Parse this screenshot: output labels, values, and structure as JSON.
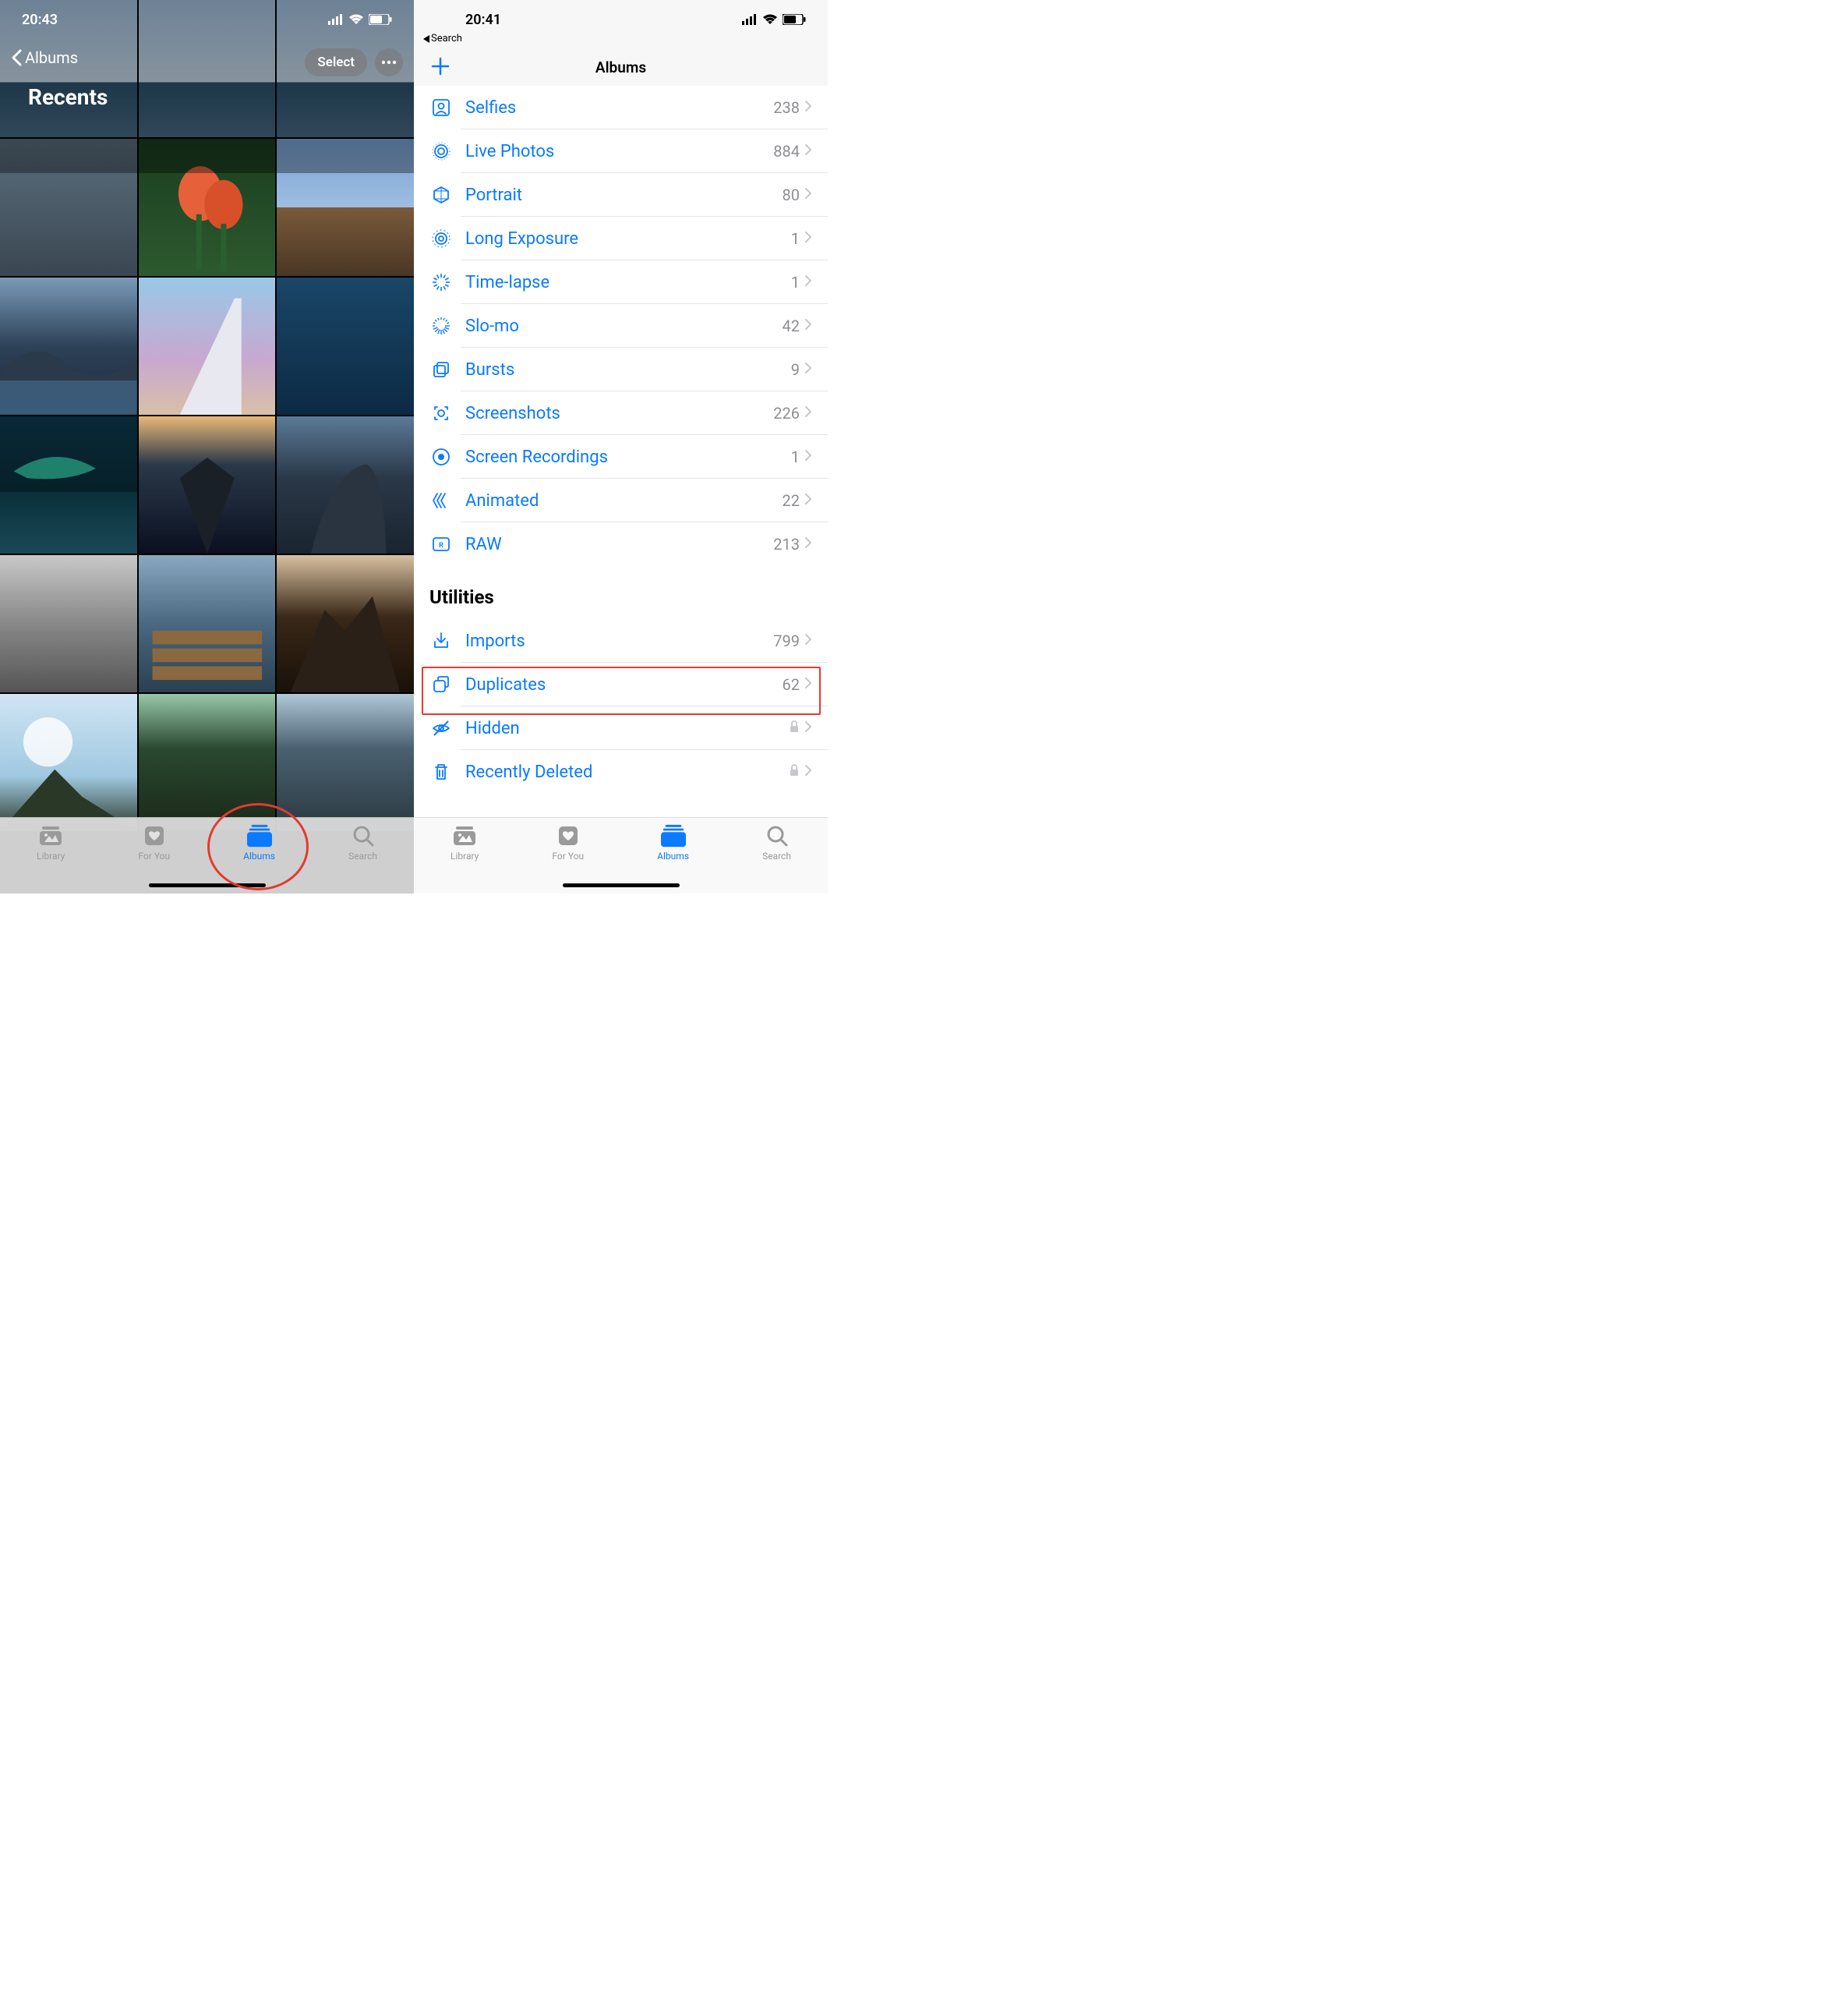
{
  "left": {
    "time": "20:43",
    "back_label": "Albums",
    "title": "Recents",
    "select_label": "Select",
    "tabs": {
      "library": "Library",
      "for_you": "For You",
      "albums": "Albums",
      "search": "Search"
    }
  },
  "right": {
    "time": "20:41",
    "breadcrumb": "Search",
    "nav_title": "Albums",
    "section_utilities": "Utilities",
    "media_types": [
      {
        "icon": "selfies-icon",
        "label": "Selfies",
        "count": "238"
      },
      {
        "icon": "live-photos-icon",
        "label": "Live Photos",
        "count": "884"
      },
      {
        "icon": "portrait-icon",
        "label": "Portrait",
        "count": "80"
      },
      {
        "icon": "long-exposure-icon",
        "label": "Long Exposure",
        "count": "1"
      },
      {
        "icon": "time-lapse-icon",
        "label": "Time-lapse",
        "count": "1"
      },
      {
        "icon": "slo-mo-icon",
        "label": "Slo-mo",
        "count": "42"
      },
      {
        "icon": "bursts-icon",
        "label": "Bursts",
        "count": "9"
      },
      {
        "icon": "screenshots-icon",
        "label": "Screenshots",
        "count": "226"
      },
      {
        "icon": "screen-recordings-icon",
        "label": "Screen Recordings",
        "count": "1"
      },
      {
        "icon": "animated-icon",
        "label": "Animated",
        "count": "22"
      },
      {
        "icon": "raw-icon",
        "label": "RAW",
        "count": "213"
      }
    ],
    "utilities": [
      {
        "icon": "imports-icon",
        "label": "Imports",
        "count": "799",
        "locked": false
      },
      {
        "icon": "duplicates-icon",
        "label": "Duplicates",
        "count": "62",
        "locked": false
      },
      {
        "icon": "hidden-icon",
        "label": "Hidden",
        "count": "",
        "locked": true
      },
      {
        "icon": "recently-deleted-icon",
        "label": "Recently Deleted",
        "count": "",
        "locked": true
      }
    ],
    "tabs": {
      "library": "Library",
      "for_you": "For You",
      "albums": "Albums",
      "search": "Search"
    }
  }
}
